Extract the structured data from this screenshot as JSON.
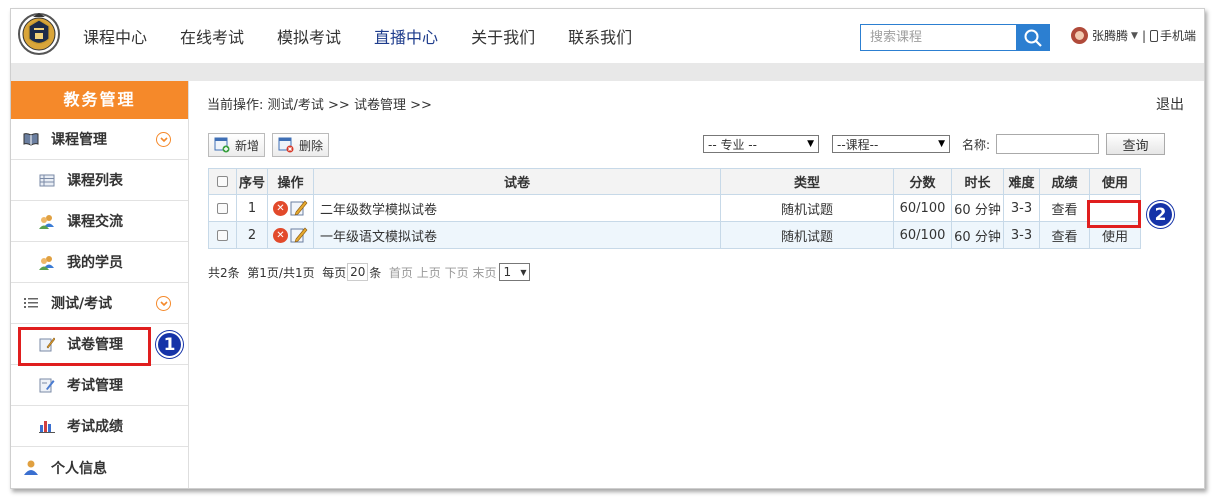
{
  "header": {
    "nav": [
      "课程中心",
      "在线考试",
      "模拟考试",
      "直播中心",
      "关于我们",
      "联系我们"
    ],
    "search_placeholder": "搜索课程",
    "user_name": "张腾腾",
    "divider": "|",
    "mobile_label": "手机端"
  },
  "sidebar": {
    "title": "教务管理",
    "items": [
      {
        "label": "课程管理",
        "icon": "book-icon"
      },
      {
        "label": "课程列表",
        "icon": "list-icon"
      },
      {
        "label": "课程交流",
        "icon": "users-icon"
      },
      {
        "label": "我的学员",
        "icon": "users-icon"
      },
      {
        "label": "测试/考试",
        "icon": "menu-icon"
      },
      {
        "label": "试卷管理",
        "icon": "edit-paper-icon"
      },
      {
        "label": "考试管理",
        "icon": "exam-icon"
      },
      {
        "label": "考试成绩",
        "icon": "bar-chart-icon"
      },
      {
        "label": "个人信息",
        "icon": "person-icon"
      }
    ]
  },
  "annotations": {
    "badge1": "1",
    "badge2": "2"
  },
  "main": {
    "breadcrumb": "当前操作: 测试/考试 >> 试卷管理 >>",
    "logout": "退出",
    "toolbar": {
      "add": "新增",
      "delete": "删除"
    },
    "filters": {
      "major": "-- 专业 --",
      "course": "--课程--",
      "name_label": "名称:",
      "name_value": "",
      "query": "查询"
    },
    "table": {
      "headers": [
        "",
        "序号",
        "操作",
        "试卷",
        "类型",
        "分数",
        "时长",
        "难度",
        "成绩",
        "使用"
      ],
      "rows": [
        {
          "no": "1",
          "name": "二年级数学模拟试卷",
          "type": "随机试题",
          "score": "60/100",
          "duration": "60 分钟",
          "difficulty": "3-3",
          "result": "查看",
          "use": ""
        },
        {
          "no": "2",
          "name": "一年级语文模拟试卷",
          "type": "随机试题",
          "score": "60/100",
          "duration": "60 分钟",
          "difficulty": "3-3",
          "result": "查看",
          "use": "使用"
        }
      ]
    },
    "pager": {
      "total": "共2条",
      "page_info": "第1页/共1页",
      "per_page_label": "每页",
      "per_page": "20",
      "per_page_unit": "条",
      "first": "首页",
      "prev": "上页",
      "next": "下页",
      "last": "末页",
      "current": "1"
    }
  }
}
